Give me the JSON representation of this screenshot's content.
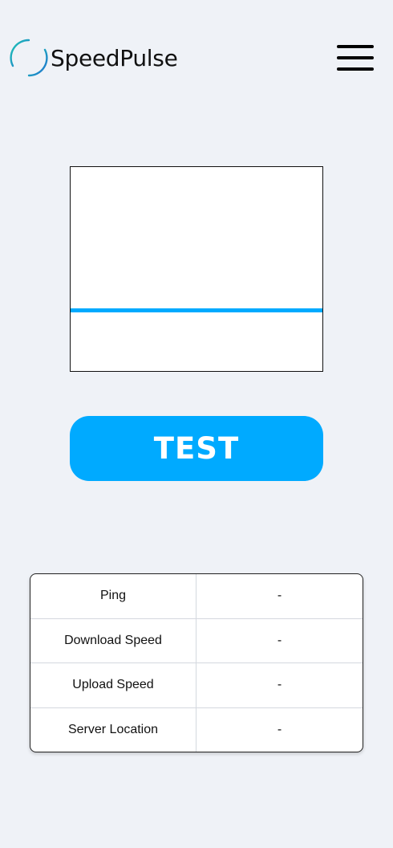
{
  "app": {
    "name": "SpeedPulse"
  },
  "colors": {
    "accent": "#00aaff",
    "background": "#eff2f7",
    "logo_gradient_start": "#1ec8b4",
    "logo_gradient_end": "#1f6fd0"
  },
  "header": {
    "menu_icon": "hamburger-menu-icon"
  },
  "test_button": {
    "label": "TEST"
  },
  "results": {
    "rows": [
      {
        "label": "Ping",
        "value": "-"
      },
      {
        "label": "Download Speed",
        "value": "-"
      },
      {
        "label": "Upload Speed",
        "value": "-"
      },
      {
        "label": "Server Location",
        "value": "-"
      }
    ]
  }
}
